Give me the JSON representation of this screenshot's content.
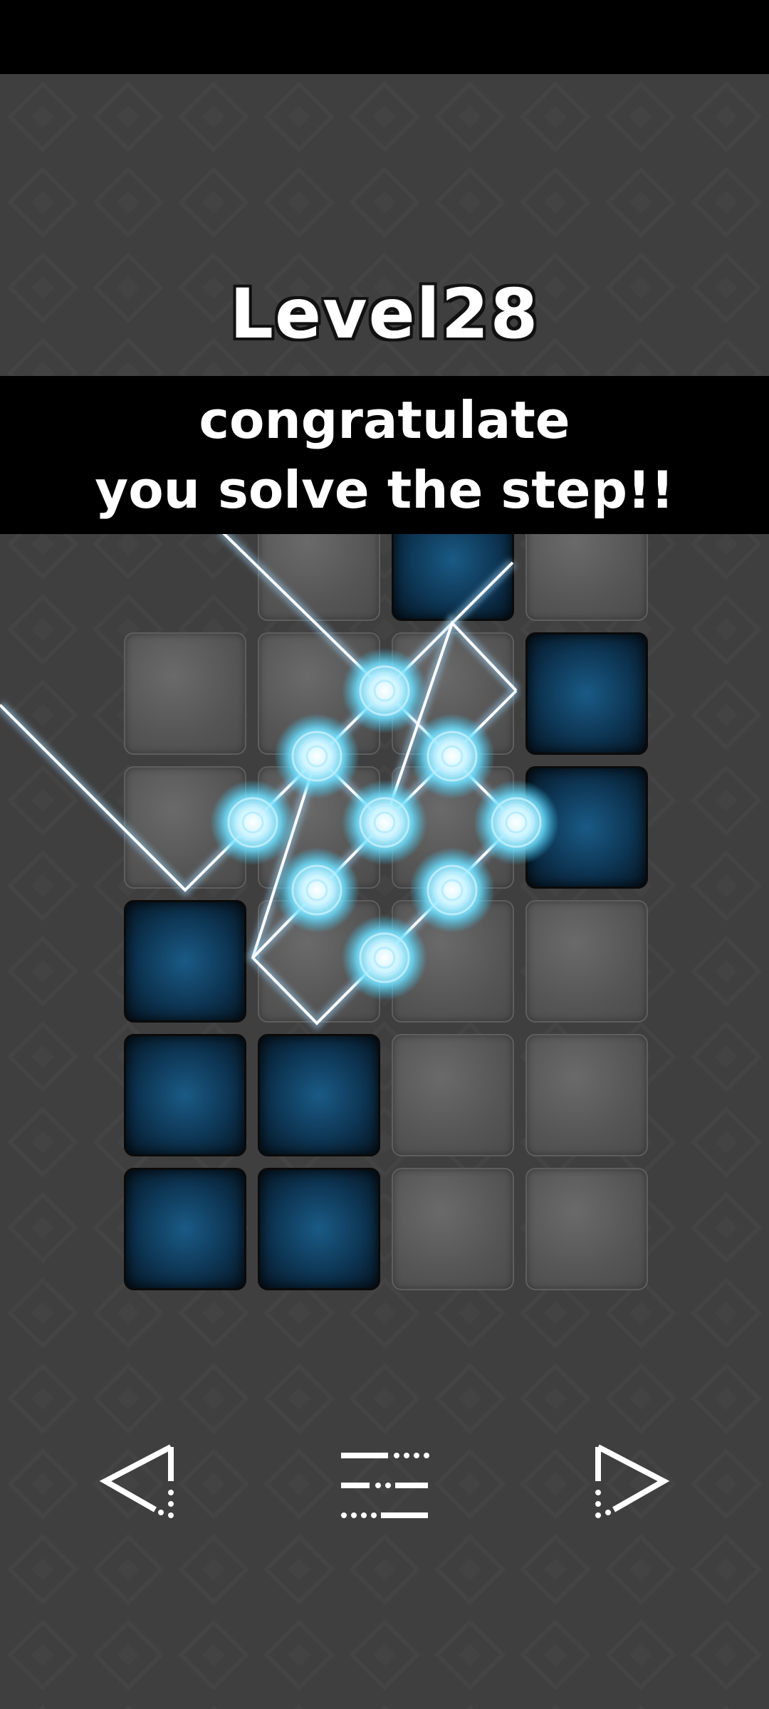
{
  "level": {
    "title": "Level28"
  },
  "banner": {
    "line1": "congratulate",
    "line2": "you solve the step!!"
  },
  "board": {
    "rows": 6,
    "cols": 4,
    "tiles": [
      [
        "none",
        "stone",
        "blue",
        "stone"
      ],
      [
        "stone",
        "stone",
        "stone",
        "blue"
      ],
      [
        "stone",
        "stone",
        "stone",
        "blue"
      ],
      [
        "blue",
        "stone",
        "stone",
        "stone"
      ],
      [
        "blue",
        "blue",
        "stone",
        "stone"
      ],
      [
        "blue",
        "blue",
        "stone",
        "stone"
      ]
    ]
  },
  "colors": {
    "background": "#3f3f3f",
    "laser": "#9fd8ff",
    "glow": "#7fe6ff",
    "tile_blue": "#1a5a85",
    "tile_stone": "#5a5a5a"
  },
  "controls": {
    "prev_icon": "triangle-left-icon",
    "menu_icon": "menu-lines-icon",
    "next_icon": "triangle-right-icon"
  }
}
